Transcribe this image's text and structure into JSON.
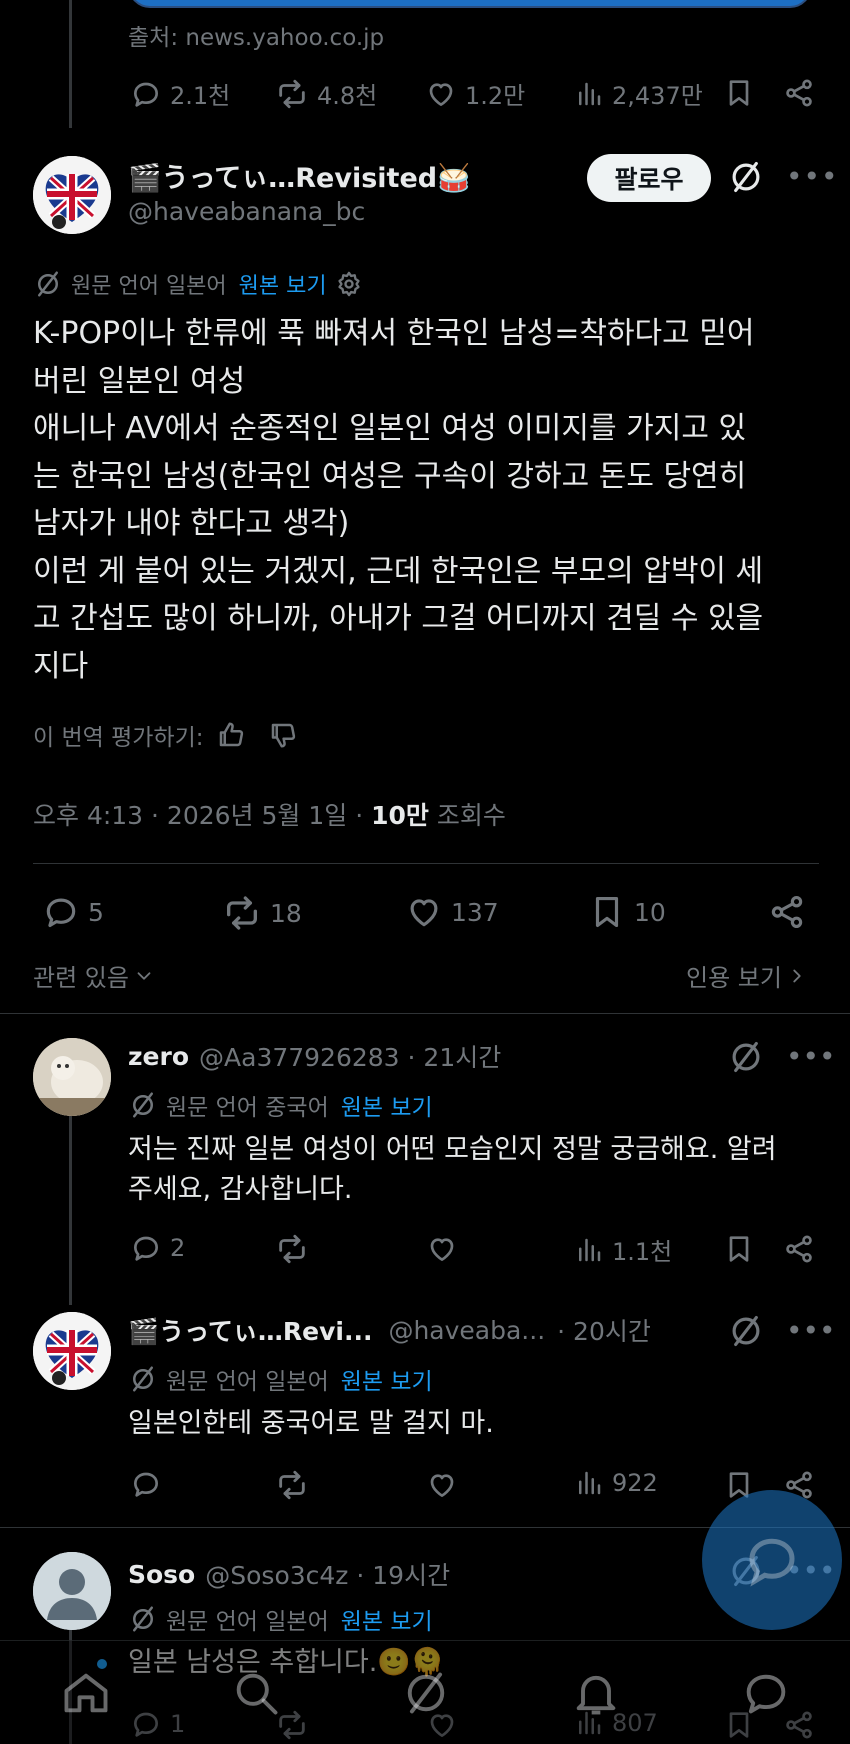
{
  "top_post": {
    "source": "출처: news.yahoo.co.jp",
    "stats": {
      "replies": "2.1천",
      "reposts": "4.8천",
      "likes": "1.2만",
      "views": "2,437만"
    }
  },
  "main_post": {
    "display_name": "🎬うってぃ…Revisited🥁",
    "handle": "@haveabanana_bc",
    "follow_label": "팔로우",
    "translated_from": "원문 언어 일본어",
    "show_original": "원본 보기",
    "text_lines": [
      "K-POP이나 한류에 푹 빠져서 한국인 남성=착하다고 믿어",
      "버린 일본인 여성",
      "애니나 AV에서 순종적인 일본인 여성 이미지를 가지고 있",
      "는 한국인 남성(한국인 여성은 구속이 강하고 돈도 당연히",
      "남자가 내야 한다고 생각)",
      "이런 게 붙어 있는 거겠지, 근데 한국인은 부모의 압박이 세",
      "고 간섭도 많이 하니까, 아내가 그걸 어디까지 견딜 수 있을",
      "지다"
    ],
    "rate_translation": "이 번역 평가하기:",
    "timestamp": "오후 4:13 · 2026년 5월 1일 · ",
    "views_count": "10만",
    "views_label": " 조회수",
    "stats": {
      "replies": "5",
      "reposts": "18",
      "likes": "137",
      "bookmarks": "10"
    },
    "related": "관련 있음",
    "quotes": "인용 보기"
  },
  "replies": [
    {
      "display_name": "zero",
      "handle_time": "@Aa377926283 · 21시간",
      "translated_from": "원문 언어 중국어",
      "show_original": "원본 보기",
      "text_lines": [
        "저는 진짜 일본 여성이 어떤 모습인지 정말 궁금해요. 알려",
        "주세요, 감사합니다."
      ],
      "stats": {
        "replies": "2",
        "views": "1.1천"
      }
    },
    {
      "display_name": "🎬うってぃ…Revi...",
      "handle": "@haveaba...",
      "time": "· 20시간",
      "translated_from": "원문 언어 일본어",
      "show_original": "원본 보기",
      "text_lines": [
        "일본인한테 중국어로 말 걸지 마."
      ],
      "stats": {
        "views": "922"
      }
    },
    {
      "display_name": "Soso",
      "handle_time": "@Soso3c4z · 19시간",
      "translated_from": "원문 언어 일본어",
      "show_original": "원본 보기",
      "text_lines": [
        "일본 남성은 추합니다.🙂🫠"
      ],
      "stats": {
        "replies": "1",
        "views": "807"
      }
    }
  ],
  "icons": [
    "reply-icon",
    "repost-icon",
    "like-icon",
    "views-icon",
    "bookmark-icon",
    "share-icon",
    "grok-icon",
    "more-icon",
    "translate-icon",
    "gear-icon",
    "thumb-up-icon",
    "thumb-down-icon",
    "chevron-down-icon",
    "chevron-right-icon",
    "home-icon",
    "search-icon",
    "bell-icon",
    "messages-icon",
    "compose-icon"
  ],
  "colors": {
    "background": "#000000",
    "text": "#e7e9ea",
    "muted": "#71767b",
    "link": "#1d9bf0",
    "fab": "#1d9bf0"
  }
}
